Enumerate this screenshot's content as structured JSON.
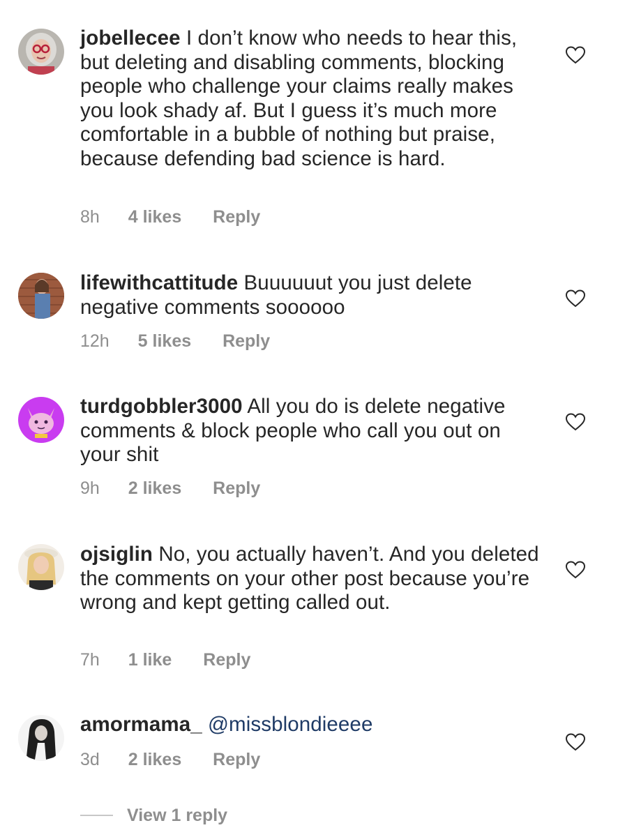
{
  "comments": [
    {
      "username": "jobellecee",
      "text": "I don’t know who needs to hear this, but deleting and disabling comments, blocking people who challenge your claims really makes you look shady af. But I guess it’s much more comfortable in a bubble of nothing but praise, because defending bad science is hard.",
      "time": "8h",
      "likes": "4 likes",
      "reply": "Reply"
    },
    {
      "username": "lifewithcattitude",
      "text": "Buuuuuut you just delete negative comments soooooo",
      "time": "12h",
      "likes": "5 likes",
      "reply": "Reply"
    },
    {
      "username": "turdgobbler3000",
      "text": "All you do is delete negative comments & block people who call you out on your shit",
      "time": "9h",
      "likes": "2 likes",
      "reply": "Reply"
    },
    {
      "username": "ojsiglin",
      "text": "No, you actually haven’t. And you deleted the comments on your other post because you’re wrong and kept getting called out.",
      "time": "7h",
      "likes": "1 like",
      "reply": "Reply"
    },
    {
      "username": "amormama_",
      "text": "@missblondieeee",
      "time": "3d",
      "likes": "2 likes",
      "reply": "Reply"
    }
  ],
  "view_replies": "View 1 reply",
  "icons": {
    "like": "heart-outline-icon"
  },
  "colors": {
    "text": "#262626",
    "meta": "#8e8e8e",
    "mention": "#1f3b66"
  }
}
